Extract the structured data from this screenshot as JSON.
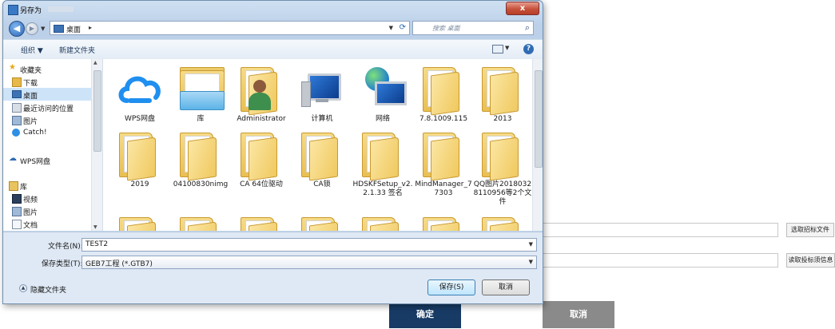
{
  "dialog": {
    "title": "另存为",
    "close_label": "x",
    "address": {
      "location": "桌面",
      "search_placeholder": "搜索 桌面"
    },
    "toolbar": {
      "organize": "组织 ▼",
      "new_folder": "新建文件夹"
    },
    "nav": [
      {
        "label": "收藏夹",
        "icon": "star-icon"
      },
      {
        "label": "下载",
        "icon": "download-folder-icon"
      },
      {
        "label": "桌面",
        "icon": "desktop-icon",
        "selected": true
      },
      {
        "label": "最近访问的位置",
        "icon": "recent-places-icon"
      },
      {
        "label": "图片",
        "icon": "pictures-icon"
      },
      {
        "label": "Catch!",
        "icon": "catch-icon"
      },
      {
        "label": "WPS网盘",
        "icon": "cloud-icon"
      },
      {
        "label": "库",
        "icon": "library-icon"
      },
      {
        "label": "视频",
        "icon": "videos-icon"
      },
      {
        "label": "图片",
        "icon": "pictures-icon"
      },
      {
        "label": "文档",
        "icon": "documents-icon"
      }
    ],
    "files": [
      {
        "name": "WPS网盘",
        "icon": "cloud-drive-icon"
      },
      {
        "name": "库",
        "icon": "library-folder-icon"
      },
      {
        "name": "Administrator",
        "icon": "user-folder-icon"
      },
      {
        "name": "计算机",
        "icon": "computer-icon"
      },
      {
        "name": "网络",
        "icon": "network-globe-icon"
      },
      {
        "name": "7.8.1009.115",
        "icon": "folder-icon"
      },
      {
        "name": "2013",
        "icon": "folder-icon"
      },
      {
        "name": "2019",
        "icon": "folder-icon"
      },
      {
        "name": "04100830nimg",
        "icon": "folder-icon"
      },
      {
        "name": "CA 64位驱动",
        "icon": "folder-icon"
      },
      {
        "name": "CA锁",
        "icon": "folder-icon"
      },
      {
        "name": "HDSKFSetup_v2.2.1.33 签名",
        "icon": "folder-icon"
      },
      {
        "name": "MindManager_77303",
        "icon": "folder-icon"
      },
      {
        "name": "QQ图片20180328110956等2个文件",
        "icon": "folder-icon"
      },
      {
        "name": "",
        "icon": "folder-icon"
      },
      {
        "name": "",
        "icon": "folder-icon"
      },
      {
        "name": "",
        "icon": "folder-icon"
      },
      {
        "name": "",
        "icon": "folder-icon"
      },
      {
        "name": "",
        "icon": "folder-icon"
      },
      {
        "name": "",
        "icon": "folder-icon"
      },
      {
        "name": "",
        "icon": "folder-icon"
      }
    ],
    "filename_label": "文件名(N):",
    "filename_value": "TEST2",
    "filetype_label": "保存类型(T):",
    "filetype_value": "GEB7工程 (*.GTB7)",
    "hide_folders": "隐藏文件夹",
    "save_button": "保存(S)",
    "cancel_button": "取消"
  },
  "page": {
    "select_bid_file": "选取招标文件",
    "read_bid_info": "读取投标须信息",
    "confirm": "确定",
    "cancel": "取消",
    "colors": {
      "confirm": "#183b66",
      "cancel": "#8a8a8a"
    }
  }
}
